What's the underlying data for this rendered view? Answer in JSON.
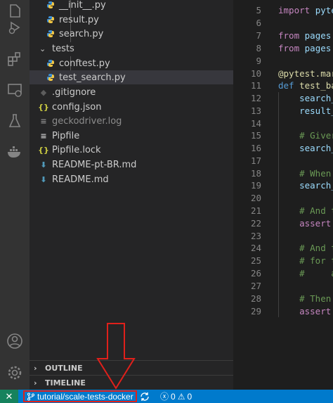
{
  "sidebar": {
    "files": [
      {
        "label": "__init__.py",
        "icon": "python-icon",
        "type": "py"
      },
      {
        "label": "result.py",
        "icon": "python-icon",
        "type": "py"
      },
      {
        "label": "search.py",
        "icon": "python-icon",
        "type": "py"
      },
      {
        "label": "tests",
        "icon": "folder-chevron",
        "type": "folder"
      },
      {
        "label": "conftest.py",
        "icon": "python-icon",
        "type": "py"
      },
      {
        "label": "test_search.py",
        "icon": "python-icon",
        "type": "py"
      },
      {
        "label": ".gitignore",
        "icon": "gitignore-icon",
        "type": "git"
      },
      {
        "label": "config.json",
        "icon": "json-icon",
        "type": "json"
      },
      {
        "label": "geckodriver.log",
        "icon": "log-icon",
        "type": "log"
      },
      {
        "label": "Pipfile",
        "icon": "pipfile-icon",
        "type": "plain"
      },
      {
        "label": "Pipfile.lock",
        "icon": "json-icon",
        "type": "json"
      },
      {
        "label": "README-pt-BR.md",
        "icon": "markdown-icon",
        "type": "md"
      },
      {
        "label": "README.md",
        "icon": "markdown-icon",
        "type": "md"
      }
    ],
    "outline_label": "OUTLINE",
    "timeline_label": "TIMELINE"
  },
  "editor": {
    "line_numbers": [
      "5",
      "6",
      "7",
      "8",
      "9",
      "10",
      "11",
      "12",
      "13",
      "14",
      "15",
      "16",
      "17",
      "18",
      "19",
      "20",
      "21",
      "22",
      "23",
      "24",
      "25",
      "26",
      "27",
      "28",
      "29"
    ],
    "lines": [
      "import pyte",
      "",
      "from pages.",
      "from pages.",
      "",
      "@pytest.mar",
      "def test_ba",
      "    search_",
      "    result_",
      "",
      "    # Giver",
      "    search_",
      "",
      "    # When",
      "    search_",
      "",
      "    # And t",
      "    assert",
      "",
      "    # And t",
      "    # for t",
      "    #     a",
      "",
      "    # Then",
      "    assert"
    ]
  },
  "statusbar": {
    "branch": "tutorial/scale-tests-docker",
    "errors": "0",
    "warnings": "0"
  },
  "colors": {
    "statusbar": "#007acc",
    "remote": "#16825d",
    "highlight": "#e0201b"
  }
}
